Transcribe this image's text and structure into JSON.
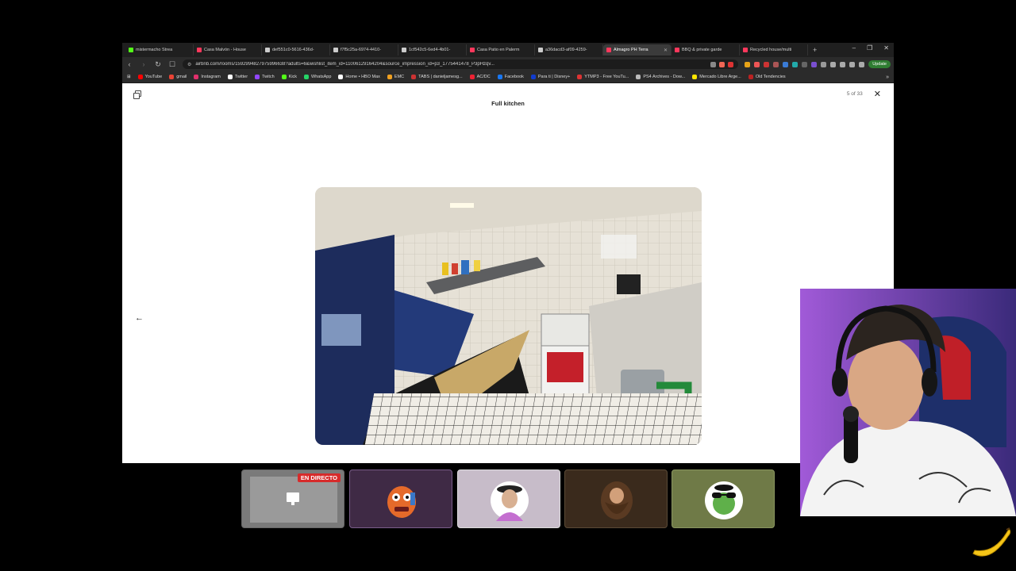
{
  "browser": {
    "tabs": [
      {
        "label": "mistermacho Strea",
        "color": "#53fc18"
      },
      {
        "label": "Casa Malvón - House",
        "color": "#ff385c"
      },
      {
        "label": "def551c0-5616-436d-",
        "color": "#cccccc"
      },
      {
        "label": "f7f5c25a-6974-4410-",
        "color": "#cccccc"
      },
      {
        "label": "1cf542c5-6ed4-4b01-",
        "color": "#cccccc"
      },
      {
        "label": "Casa Patio en Palerm",
        "color": "#ff385c"
      },
      {
        "label": "a36dacd3-af09-4259-",
        "color": "#cccccc"
      },
      {
        "label": "Almagro PH Terra",
        "color": "#ff385c",
        "active": true
      },
      {
        "label": "BBQ & private garde",
        "color": "#ff385c"
      },
      {
        "label": "Recycled house/multi",
        "color": "#ff385c"
      }
    ],
    "new_tab": "+",
    "window_controls": {
      "minimize": "–",
      "restore": "❐",
      "close": "✕"
    },
    "url": "airbnb.com/rooms/1592994827975996638?adults=6&wishlist_item_id=11006129164204&source_impression_id=p3_1775441478_P3pHzqv...",
    "update_label": "Update",
    "bookmarks": [
      {
        "label": "YouTube",
        "color": "#ff0000"
      },
      {
        "label": "gmail",
        "color": "#ea4335"
      },
      {
        "label": "Instagram",
        "color": "#e1306c"
      },
      {
        "label": "Twitter",
        "color": "#ffffff"
      },
      {
        "label": "Twitch",
        "color": "#9146ff"
      },
      {
        "label": "Kick",
        "color": "#53fc18"
      },
      {
        "label": "WhatsApp",
        "color": "#25d366"
      },
      {
        "label": "Home • HBO Max",
        "color": "#ffffff"
      },
      {
        "label": "EMC",
        "color": "#f0a020"
      },
      {
        "label": "TABS | danieljamesg...",
        "color": "#cc3333"
      },
      {
        "label": "AC/DC",
        "color": "#e23"
      },
      {
        "label": "Facebook",
        "color": "#1877f2"
      },
      {
        "label": "Para ti | Disney+",
        "color": "#113ccf"
      },
      {
        "label": "YTMP3 - Free YouTu...",
        "color": "#d33"
      },
      {
        "label": "PS4 Archives - Dow...",
        "color": "#bbbbbb"
      },
      {
        "label": "Mercado Libre Arge...",
        "color": "#ffe600"
      },
      {
        "label": "Old Tendencies",
        "color": "#b22"
      }
    ]
  },
  "viewer": {
    "title": "Full kitchen",
    "counter": "5 of 33",
    "close_icon": "close-icon",
    "prev_icon": "arrow-left-icon",
    "next_icon": "arrow-right-icon",
    "prev_glyph": "←",
    "next_glyph": "→",
    "close_glyph": "✕"
  },
  "stream": {
    "live_label": "EN DIRECTO",
    "participants": [
      "screen-share",
      "orange-monster",
      "person-hat",
      "bearded-man",
      "frog-sunglasses"
    ]
  }
}
